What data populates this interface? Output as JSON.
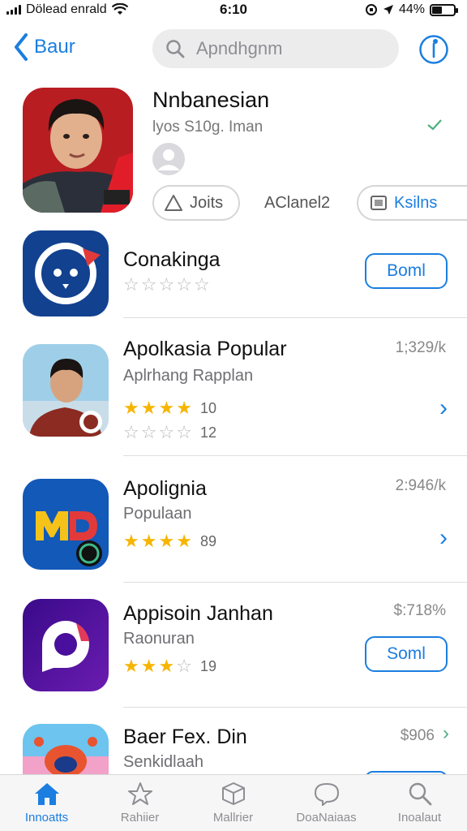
{
  "status_bar": {
    "carrier": "Dölead enrald",
    "time": "6:10",
    "battery": "44%",
    "battery_level": 0.44
  },
  "nav": {
    "back_label": "Baur",
    "search_placeholder": "Apndhgnm"
  },
  "featured": {
    "title": "Nnbanesian",
    "subtitle": "lyos S10g.  Iman",
    "chips": [
      "Joits",
      "AClanel2",
      "Ksilns"
    ]
  },
  "apps": [
    {
      "name": "Conakinga",
      "subtitle": "",
      "stars": 0,
      "rating_count": "",
      "size": "",
      "action": "Boml"
    },
    {
      "name": "Apolkasia Popular",
      "subtitle": "Aplrhang Rapplan",
      "stars": 4,
      "rating_count": "10",
      "second_rating_count": "12",
      "size": "1;329/k",
      "action": ""
    },
    {
      "name": "Apolignia",
      "subtitle": "Populaan",
      "stars": 4,
      "rating_count": "89",
      "size": "2:946/k",
      "action": ""
    },
    {
      "name": "Appisoin Janhan",
      "subtitle": "Raonuran",
      "stars": 3,
      "rating_count": "19",
      "size": "$:718%",
      "action": "Soml"
    },
    {
      "name": "Baer Fex. Din",
      "subtitle": "Senkidlaah",
      "stars": 0,
      "rating_count": "",
      "size": "$906",
      "action": ""
    }
  ],
  "tabs": [
    {
      "label": "Innoatts",
      "icon": "home-icon",
      "active": true
    },
    {
      "label": "Rahiier",
      "icon": "star-icon",
      "active": false
    },
    {
      "label": "Mallrier",
      "icon": "cube-icon",
      "active": false
    },
    {
      "label": "DoaNaiaas",
      "icon": "chat-icon",
      "active": false
    },
    {
      "label": "Inoalaut",
      "icon": "search-icon",
      "active": false
    }
  ],
  "colors": {
    "accent": "#1b7ee0",
    "star": "#f6b500"
  }
}
